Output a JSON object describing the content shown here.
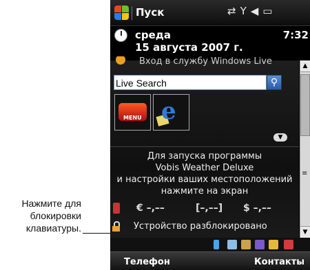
{
  "callout": {
    "lines": [
      "Нажмите для",
      "блокировки",
      "клавиатуры."
    ]
  },
  "titlebar": {
    "title": "Пуск",
    "status_icons": [
      "connectivity-icon",
      "signal-icon",
      "speaker-icon",
      "battery-icon"
    ]
  },
  "today": {
    "day": "среда",
    "date": "15 августа 2007 г.",
    "time": "7:32"
  },
  "windows_live": {
    "label": "Вход в службу Windows Live"
  },
  "search": {
    "value": "Live Search"
  },
  "apps": [
    {
      "name": "mio-menu",
      "label": "MENU"
    },
    {
      "name": "internet-explorer",
      "label": "e"
    }
  ],
  "weather": {
    "lines": [
      "Для запуска программы",
      "Vobis Weather Deluxe",
      "и настройки ваших местоположений",
      "нажмите на экран"
    ]
  },
  "rates": {
    "euro": "€ –,––",
    "middle": "[–,––]",
    "dollar": "$ –,––"
  },
  "lock": {
    "status": "Устройство разблокировано"
  },
  "softkeys": {
    "left": "Телефон",
    "right": "Контакты"
  },
  "colors": {
    "accent_blue": "#2a5aa8",
    "lock_orange": "#e6a23c"
  }
}
